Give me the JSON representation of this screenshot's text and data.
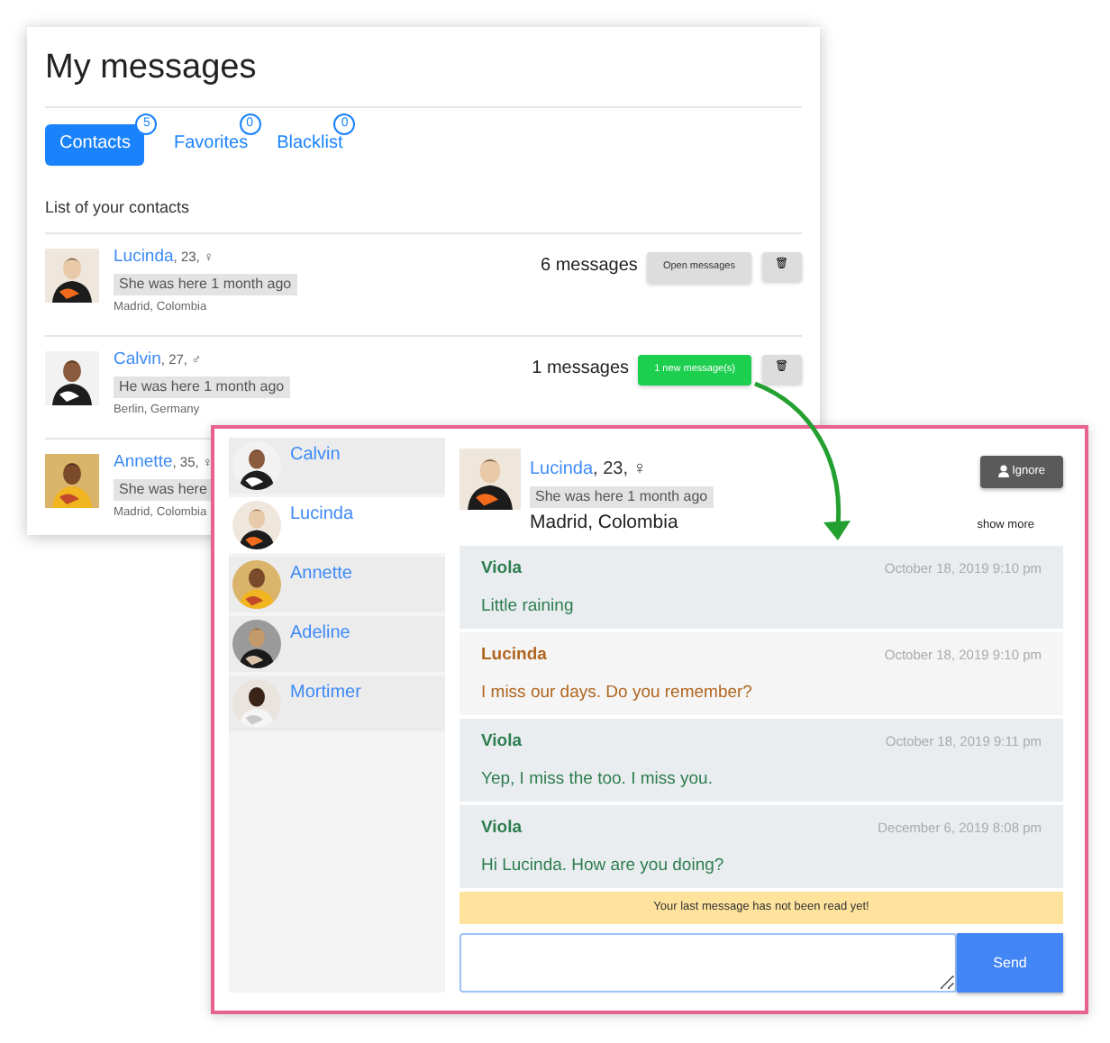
{
  "contacts_page": {
    "title": "My messages",
    "tabs": [
      {
        "label": "Contacts",
        "count": "5",
        "selected": true
      },
      {
        "label": "Favorites",
        "count": "0",
        "selected": false
      },
      {
        "label": "Blacklist",
        "count": "0",
        "selected": false
      }
    ],
    "list_heading": "List of your contacts",
    "contacts": [
      {
        "name": "Lucinda",
        "meta": ", 23, ♀",
        "last_seen": "She was here 1 month ago",
        "location": "Madrid, Colombia",
        "messages": "6 messages",
        "action": {
          "label": "Open messages",
          "kind": "open"
        },
        "delete_icon": "🗑"
      },
      {
        "name": "Calvin",
        "meta": ", 27, ♂",
        "last_seen": "He was here 1 month ago",
        "location": "Berlin, Germany",
        "messages": "1 messages",
        "action": {
          "label": "1 new message(s)",
          "kind": "new"
        },
        "delete_icon": "🗑"
      },
      {
        "name": "Annette",
        "meta": ", 35, ♀",
        "last_seen": "She was here",
        "location": "Madrid, Colombia"
      }
    ]
  },
  "chat_window": {
    "sidebar": {
      "items": [
        {
          "name": "Calvin",
          "selected": false
        },
        {
          "name": "Lucinda",
          "selected": true
        },
        {
          "name": "Annette",
          "selected": false
        },
        {
          "name": "Adeline",
          "selected": false
        },
        {
          "name": "Mortimer",
          "selected": false
        }
      ]
    },
    "header": {
      "name": "Lucinda",
      "meta": ", 23, ♀",
      "last_seen": "She was here 1 month ago",
      "location": "Madrid, Colombia",
      "ignore_button": "Ignore",
      "show_more": "show more"
    },
    "messages": [
      {
        "author": "Viola",
        "kind": "own",
        "time": "October 18, 2019 9:10 pm",
        "text": "Little raining"
      },
      {
        "author": "Lucinda",
        "kind": "other",
        "time": "October 18, 2019 9:10 pm",
        "text": "I miss our days. Do you remember?"
      },
      {
        "author": "Viola",
        "kind": "own",
        "time": "October 18, 2019 9:11 pm",
        "text": "Yep, I miss the too. I miss you."
      },
      {
        "author": "Viola",
        "kind": "own",
        "time": "December 6, 2019 8:08 pm",
        "text": "Hi Lucinda. How are you doing?"
      }
    ],
    "notice": "Your last message has not been read yet!",
    "send_button": "Send"
  }
}
